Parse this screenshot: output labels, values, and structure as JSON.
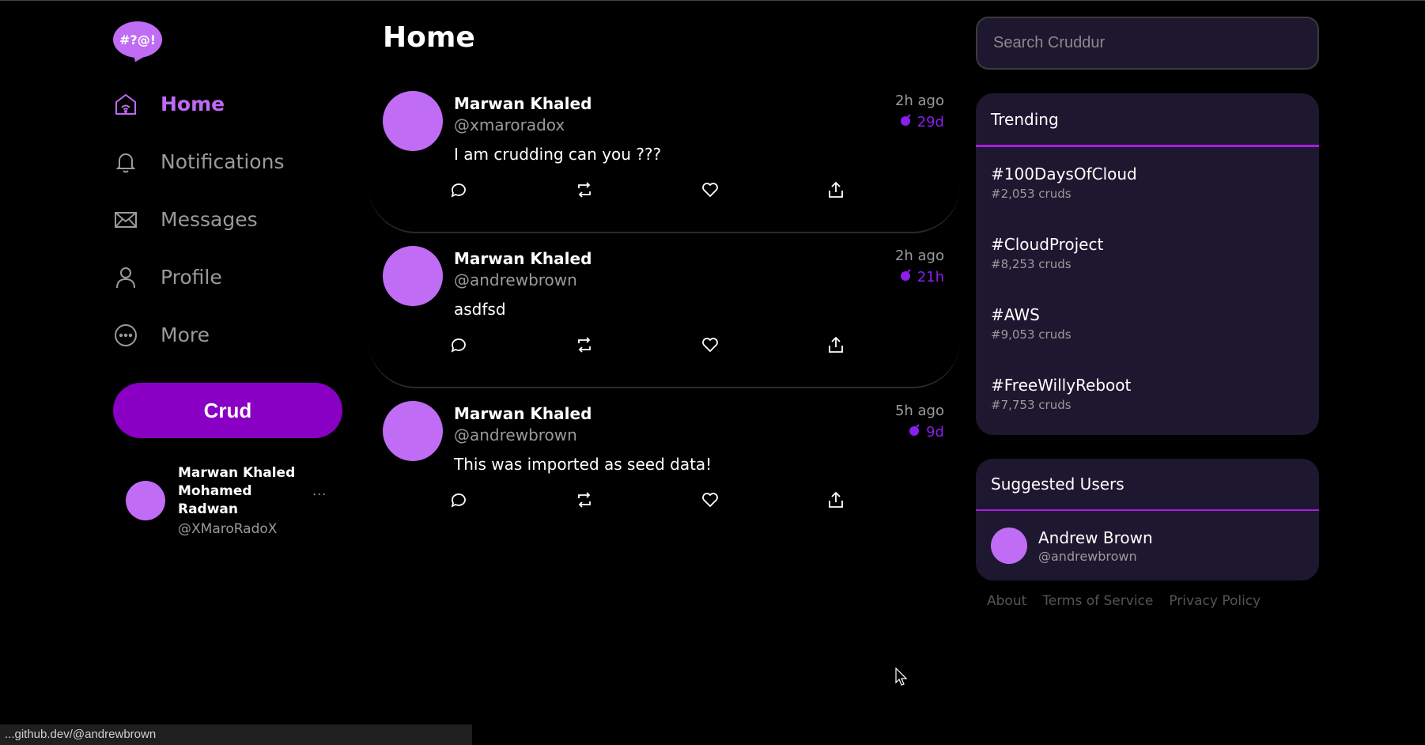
{
  "app": {
    "logo_text": "#?@!",
    "brand_color": "#c06cf4",
    "accent_color": "#8900c4"
  },
  "sidebar": {
    "items": [
      {
        "label": "Home",
        "icon": "home-icon",
        "active": true
      },
      {
        "label": "Notifications",
        "icon": "bell-icon",
        "active": false
      },
      {
        "label": "Messages",
        "icon": "envelope-icon",
        "active": false
      },
      {
        "label": "Profile",
        "icon": "user-icon",
        "active": false
      },
      {
        "label": "More",
        "icon": "more-circle-icon",
        "active": false
      }
    ],
    "crud_button": "Crud",
    "profile": {
      "name": "Marwan Khaled Mohamed Radwan",
      "handle": "@XMaroRadoX",
      "menu": "..."
    }
  },
  "main": {
    "title": "Home",
    "posts": [
      {
        "name": "Marwan Khaled",
        "handle": "@xmaroradox",
        "body": "I am crudding can you ???",
        "time": "2h ago",
        "expires": "29d"
      },
      {
        "name": "Marwan Khaled",
        "handle": "@andrewbrown",
        "body": "asdfsd",
        "time": "2h ago",
        "expires": "21h"
      },
      {
        "name": "Marwan Khaled",
        "handle": "@andrewbrown",
        "body": "This was imported as seed data!",
        "time": "5h ago",
        "expires": "9d"
      }
    ]
  },
  "right": {
    "search_placeholder": "Search Cruddur",
    "trending": {
      "title": "Trending",
      "items": [
        {
          "tag": "#100DaysOfCloud",
          "count": "#2,053 cruds"
        },
        {
          "tag": "#CloudProject",
          "count": "#8,253 cruds"
        },
        {
          "tag": "#AWS",
          "count": "#9,053 cruds"
        },
        {
          "tag": "#FreeWillyReboot",
          "count": "#7,753 cruds"
        }
      ]
    },
    "suggested": {
      "title": "Suggested Users",
      "users": [
        {
          "name": "Andrew Brown",
          "handle": "@andrewbrown"
        }
      ]
    },
    "footer": [
      "About",
      "Terms of Service",
      "Privacy Policy"
    ]
  },
  "statusbar": {
    "url": "...github.dev/@andrewbrown"
  }
}
